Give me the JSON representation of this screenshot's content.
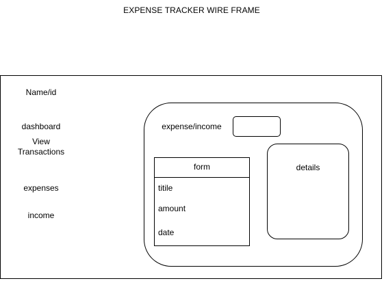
{
  "title": "EXPENSE TRACKER WIRE FRAME",
  "sidebar": {
    "name_id": "Name/id",
    "dashboard": "dashboard",
    "view_transactions_line1": "View",
    "view_transactions_line2": "Transactions",
    "expenses": "expenses",
    "income": "income"
  },
  "main": {
    "expense_income_label": "expense/income",
    "details_label": "details",
    "form": {
      "header": "form",
      "fields": [
        "titile",
        "amount",
        "date"
      ]
    }
  }
}
